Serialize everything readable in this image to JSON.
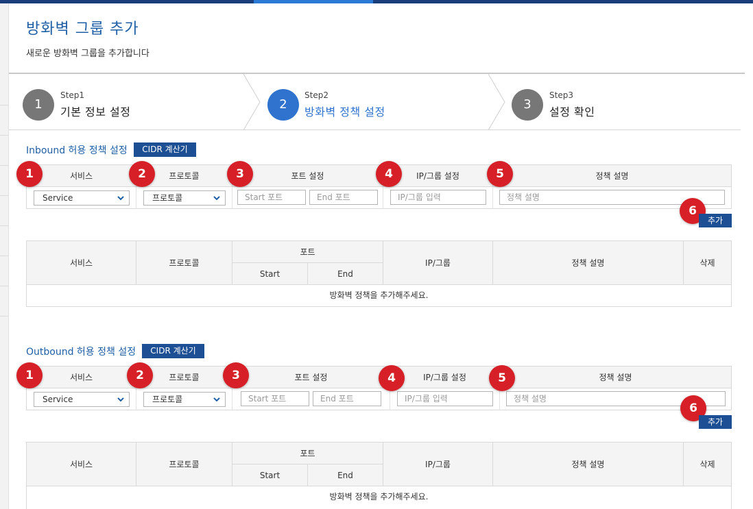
{
  "page": {
    "title": "방화벽 그룹 추가",
    "subtitle": "새로운 방화벽 그룹을 추가합니다"
  },
  "stepper": [
    {
      "label": "Step1",
      "name": "기본 정보 설정",
      "number": "1",
      "active": false
    },
    {
      "label": "Step2",
      "name": "방화벽 정책 설정",
      "number": "2",
      "active": true
    },
    {
      "label": "Step3",
      "name": "설정 확인",
      "number": "3",
      "active": false
    }
  ],
  "inbound": {
    "title": "Inbound 허용 정책 설정",
    "cidr_label": "CIDR 계산기",
    "form_headers": [
      "서비스",
      "프로토콜",
      "포트 설정",
      "IP/그룹 설정",
      "정책 설명"
    ],
    "service_value": "Service",
    "protocol_value": "프로토콜",
    "start_port_placeholder": "Start 포트",
    "end_port_placeholder": "End 포트",
    "ip_placeholder": "IP/그룹 입력",
    "desc_placeholder": "정책 설명",
    "add_label": "추가",
    "badges": [
      "1",
      "2",
      "3",
      "4",
      "5",
      "6"
    ],
    "list_headers": {
      "service": "서비스",
      "protocol": "프로토콜",
      "port": "포트",
      "start": "Start",
      "end": "End",
      "ip": "IP/그룹",
      "desc": "정책 설명",
      "delete": "삭제"
    },
    "empty_message": "방화벽 정책을 추가해주세요."
  },
  "outbound": {
    "title": "Outbound 허용 정책 설정",
    "cidr_label": "CIDR 계산기",
    "form_headers": [
      "서비스",
      "프로토콜",
      "포트 설정",
      "IP/그룹 설정",
      "정책 설명"
    ],
    "service_value": "Service",
    "protocol_value": "프로토콜",
    "start_port_placeholder": "Start 포트",
    "end_port_placeholder": "End 포트",
    "ip_placeholder": "IP/그룹 입력",
    "desc_placeholder": "정책 설명",
    "add_label": "추가",
    "badges": [
      "1",
      "2",
      "3",
      "4",
      "5",
      "6"
    ],
    "list_headers": {
      "service": "서비스",
      "protocol": "프로토콜",
      "port": "포트",
      "start": "Start",
      "end": "End",
      "ip": "IP/그룹",
      "desc": "정책 설명",
      "delete": "삭제"
    },
    "empty_message": "방화벽 정책을 추가해주세요."
  },
  "colors": {
    "accent": "#1f5fa6",
    "button": "#1c4f94",
    "step_active": "#2f73cf",
    "step_inactive": "#777777",
    "badge": "#d61f26"
  }
}
